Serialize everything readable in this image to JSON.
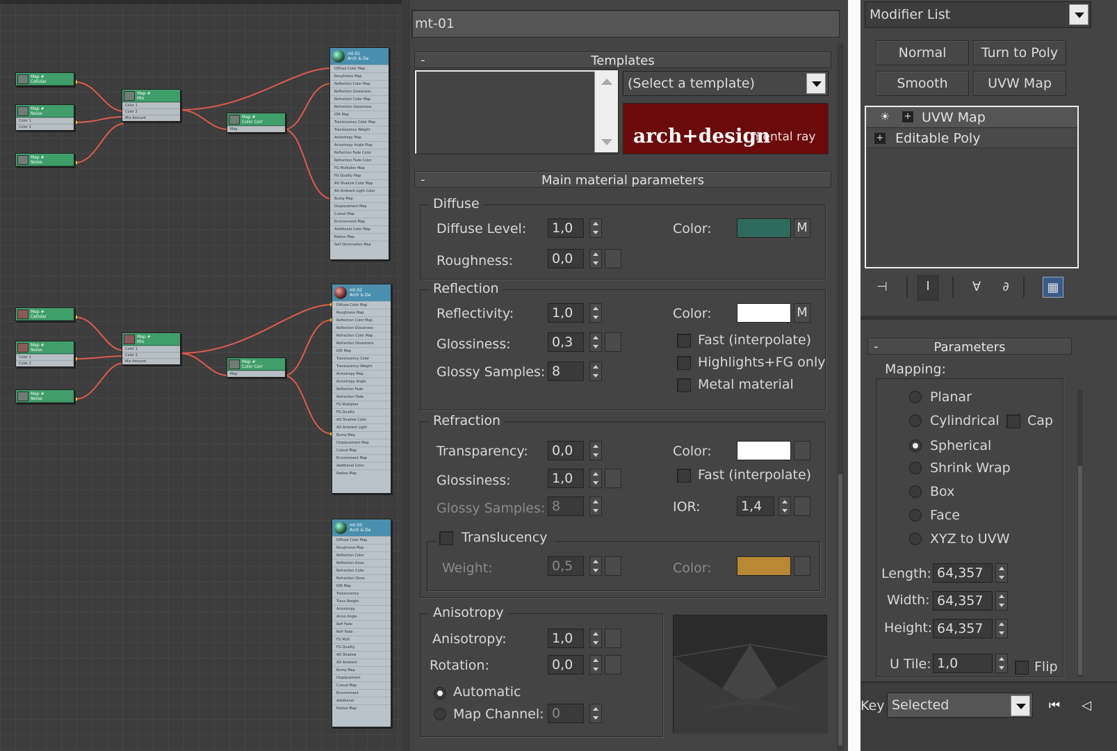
{
  "material_name": "mt-01",
  "templates": {
    "header": "Templates",
    "select_placeholder": "(Select a template)",
    "logo_main": "arch+design",
    "logo_sub": "mental ray",
    "logo_bg": "#6b0a0a"
  },
  "main_params": {
    "header": "Main material parameters",
    "diffuse": {
      "group": "Diffuse",
      "level_label": "Diffuse Level:",
      "level_value": "1,0",
      "roughness_label": "Roughness:",
      "roughness_value": "0,0",
      "color_label": "Color:",
      "color": "#2e6a5e",
      "map_btn": "M"
    },
    "reflection": {
      "group": "Reflection",
      "reflectivity_label": "Reflectivity:",
      "reflectivity_value": "1,0",
      "glossiness_label": "Glossiness:",
      "glossiness_value": "0,3",
      "samples_label": "Glossy Samples:",
      "samples_value": "8",
      "color_label": "Color:",
      "color": "#ffffff",
      "map_btn": "M",
      "fast_label": "Fast (interpolate)",
      "highlights_label": "Highlights+FG only",
      "metal_label": "Metal material"
    },
    "refraction": {
      "group": "Refraction",
      "transparency_label": "Transparency:",
      "transparency_value": "0,0",
      "glossiness_label": "Glossiness:",
      "glossiness_value": "1,0",
      "samples_label": "Glossy Samples:",
      "samples_value": "8",
      "color_label": "Color:",
      "color": "#ffffff",
      "fast_label": "Fast (interpolate)",
      "ior_label": "IOR:",
      "ior_value": "1,4",
      "translucency_label": "Translucency",
      "weight_label": "Weight:",
      "weight_value": "0,5",
      "trans_color_label": "Color:",
      "trans_color": "#b88834"
    },
    "anisotropy": {
      "group": "Anisotropy",
      "anisotropy_label": "Anisotropy:",
      "anisotropy_value": "1,0",
      "rotation_label": "Rotation:",
      "rotation_value": "0,0",
      "automatic_label": "Automatic",
      "map_channel_label": "Map Channel:",
      "map_channel_value": "0"
    }
  },
  "modifier_panel": {
    "modifier_list": "Modifier List",
    "buttons": [
      "Normal",
      "Turn to Poly",
      "Smooth",
      "UVW Map"
    ],
    "stack": [
      "UVW Map",
      "Editable Poly"
    ],
    "parameters_header": "Parameters",
    "mapping_label": "Mapping:",
    "mapping_options": [
      "Planar",
      "Cylindrical",
      "Spherical",
      "Shrink Wrap",
      "Box",
      "Face",
      "XYZ to UVW"
    ],
    "selected_mapping": "Spherical",
    "cap_label": "Cap",
    "length_label": "Length:",
    "length_value": "64,357",
    "width_label": "Width:",
    "width_value": "64,357",
    "height_label": "Height:",
    "height_value": "64,357",
    "utile_label": "U Tile:",
    "utile_value": "1,0",
    "flip_label": "Flip"
  },
  "bottom_bar": {
    "key_label": "Key",
    "selected_value": "Selected"
  }
}
